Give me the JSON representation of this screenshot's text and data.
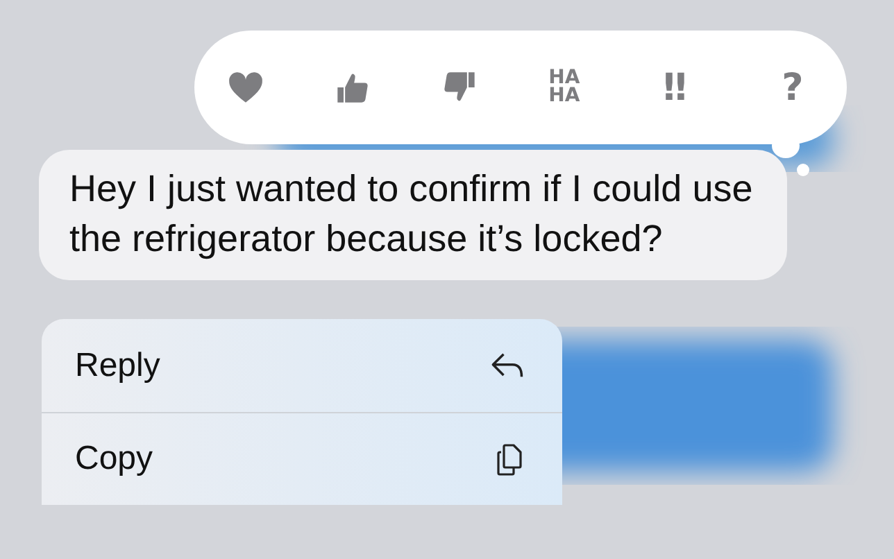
{
  "reactions": [
    {
      "kind": "heart"
    },
    {
      "kind": "thumbs-up"
    },
    {
      "kind": "thumbs-down"
    },
    {
      "kind": "text",
      "label": "HA HA"
    },
    {
      "kind": "text",
      "label": "‼"
    },
    {
      "kind": "text",
      "label": "?"
    }
  ],
  "message": {
    "text": "Hey I just wanted to confirm if I could use the refrigerator because it’s locked?"
  },
  "menu": [
    {
      "label": "Reply",
      "kind": "reply"
    },
    {
      "label": "Copy",
      "kind": "copy"
    }
  ]
}
